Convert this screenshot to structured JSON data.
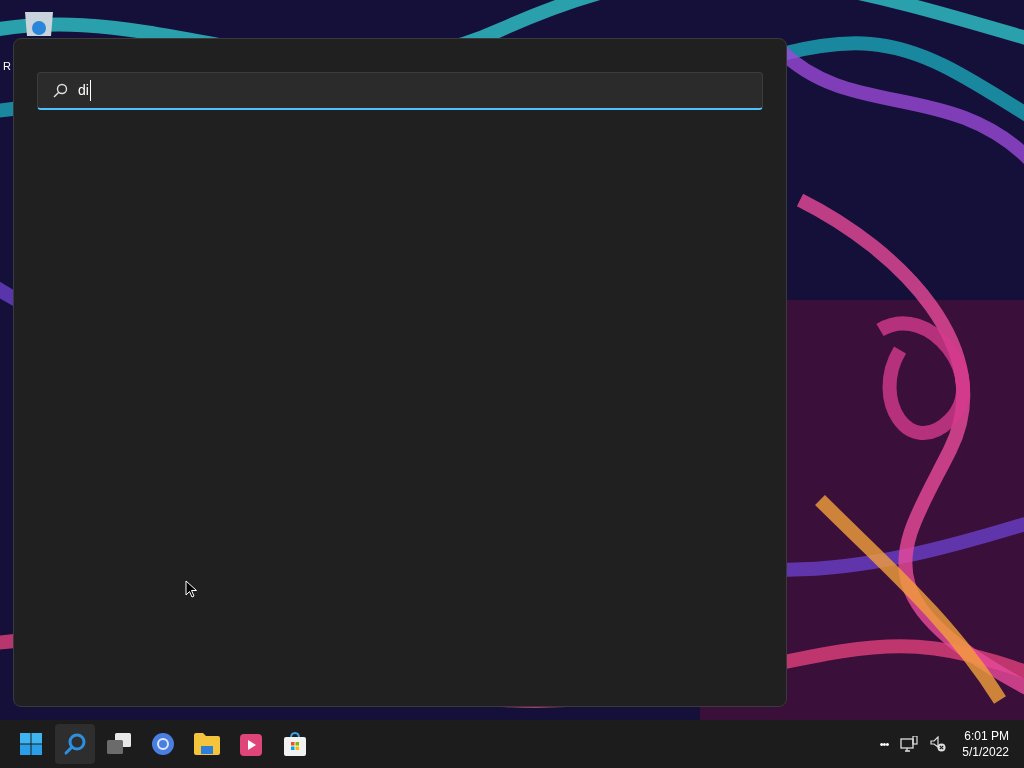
{
  "desktop": {
    "icon_label": "R"
  },
  "search_panel": {
    "query": "di"
  },
  "taskbar": {
    "apps": [
      {
        "kind": "start",
        "selected": false
      },
      {
        "kind": "search",
        "selected": true
      },
      {
        "kind": "taskview",
        "selected": false
      },
      {
        "kind": "browser",
        "selected": false
      },
      {
        "kind": "folder",
        "selected": false
      },
      {
        "kind": "media",
        "selected": false
      },
      {
        "kind": "store",
        "selected": false
      }
    ],
    "overflow": "•••",
    "time": "6:01 PM",
    "date": "5/1/2022"
  }
}
